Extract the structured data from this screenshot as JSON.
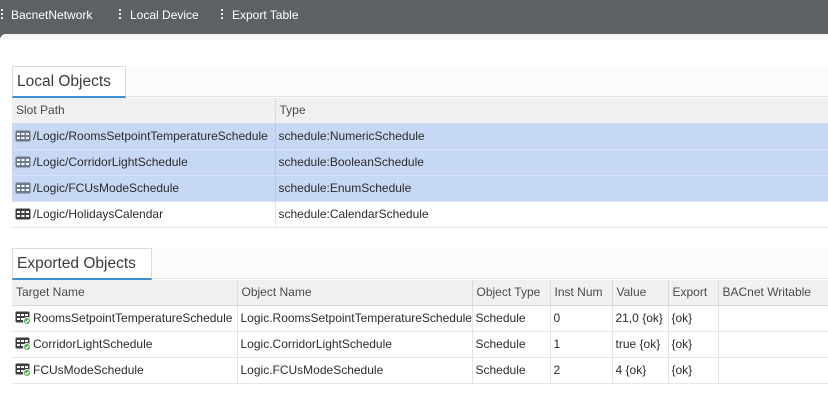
{
  "breadcrumb": {
    "items": [
      "BacnetNetwork",
      "Local Device",
      "Export Table"
    ]
  },
  "local_objects": {
    "title": "Local Objects",
    "columns": [
      "Slot Path",
      "Type"
    ],
    "rows": [
      {
        "slot_path": "/Logic/RoomsSetpointTemperatureSchedule",
        "type": "schedule:NumericSchedule",
        "selected": true
      },
      {
        "slot_path": "/Logic/CorridorLightSchedule",
        "type": "schedule:BooleanSchedule",
        "selected": true
      },
      {
        "slot_path": "/Logic/FCUsModeSchedule",
        "type": "schedule:EnumSchedule",
        "selected": true
      },
      {
        "slot_path": "/Logic/HolidaysCalendar",
        "type": "schedule:CalendarSchedule",
        "selected": false
      }
    ]
  },
  "exported_objects": {
    "title": "Exported Objects",
    "columns": [
      "Target Name",
      "Object Name",
      "Object Type",
      "Inst Num",
      "Value",
      "Export",
      "BACnet Writable"
    ],
    "rows": [
      {
        "target_name": "RoomsSetpointTemperatureSchedule",
        "object_name": "Logic.RoomsSetpointTemperatureSchedule",
        "object_type": "Schedule",
        "inst_num": "0",
        "value": "21,0 {ok}",
        "export": "{ok}",
        "bacnet_writable": ""
      },
      {
        "target_name": "CorridorLightSchedule",
        "object_name": "Logic.CorridorLightSchedule",
        "object_type": "Schedule",
        "inst_num": "1",
        "value": "true {ok}",
        "export": "{ok}",
        "bacnet_writable": ""
      },
      {
        "target_name": "FCUsModeSchedule",
        "object_name": "Logic.FCUsModeSchedule",
        "object_type": "Schedule",
        "inst_num": "2",
        "value": "4 {ok}",
        "export": "{ok}",
        "bacnet_writable": ""
      }
    ]
  },
  "icons": {
    "schedule_row": "schedule-icon",
    "export_row": "schedule-export-icon",
    "breadcrumb_separator": "vertical-dots-icon"
  },
  "colors": {
    "top_bar": "#5d6166",
    "selected_row": "#c7d8f5",
    "tab_accent": "#3f8fd2",
    "header_bg": "#eef0f2"
  }
}
